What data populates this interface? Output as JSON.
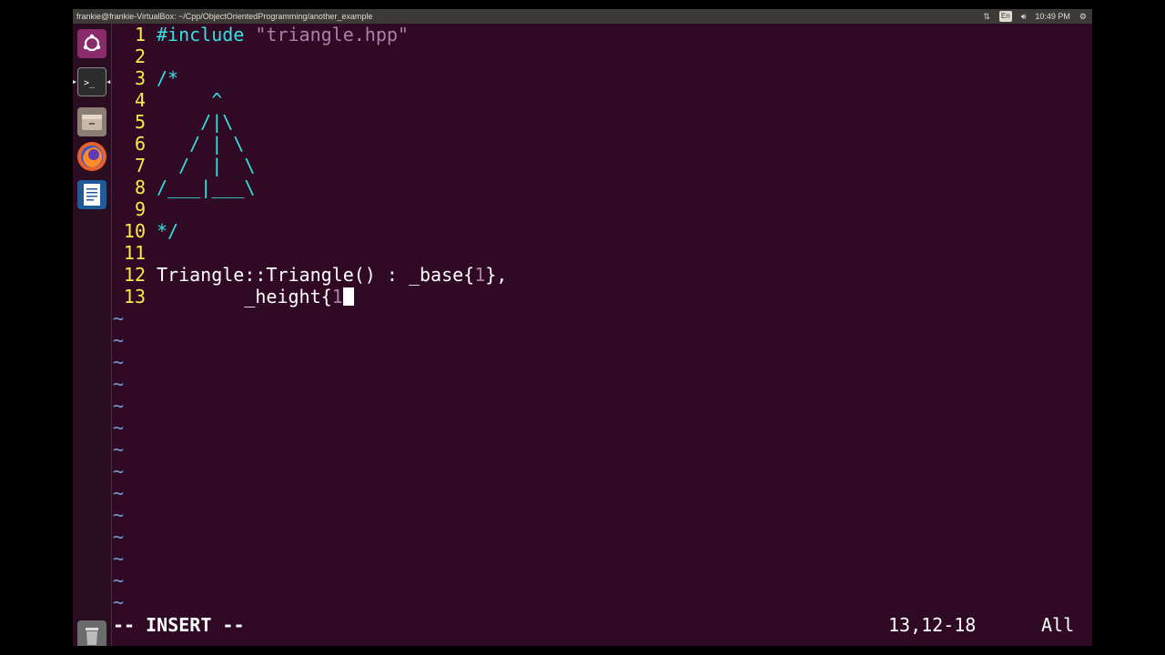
{
  "topbar": {
    "title": "frankie@frankie-VirtualBox: ~/Cpp/ObjectOrientedProgramming/another_example",
    "lang": "En",
    "clock": "10:49 PM"
  },
  "editor": {
    "lines": [
      {
        "num": "1",
        "parts": [
          {
            "t": "#include ",
            "c": "c-pre"
          },
          {
            "t": "\"triangle.hpp\"",
            "c": "c-str"
          }
        ]
      },
      {
        "num": "2",
        "parts": []
      },
      {
        "num": "3",
        "parts": [
          {
            "t": "/*",
            "c": "c-com"
          }
        ]
      },
      {
        "num": "4",
        "parts": [
          {
            "t": "     ^",
            "c": "c-com"
          }
        ]
      },
      {
        "num": "5",
        "parts": [
          {
            "t": "    /|\\",
            "c": "c-com"
          }
        ]
      },
      {
        "num": "6",
        "parts": [
          {
            "t": "   / | \\",
            "c": "c-com"
          }
        ]
      },
      {
        "num": "7",
        "parts": [
          {
            "t": "  /  |  \\",
            "c": "c-com"
          }
        ]
      },
      {
        "num": "8",
        "parts": [
          {
            "t": "/___|___\\",
            "c": "c-com"
          }
        ]
      },
      {
        "num": "9",
        "parts": []
      },
      {
        "num": "10",
        "parts": [
          {
            "t": "*/",
            "c": "c-com"
          }
        ]
      },
      {
        "num": "11",
        "parts": []
      },
      {
        "num": "12",
        "parts": [
          {
            "t": "Triangle::Triangle() : _base{",
            "c": ""
          },
          {
            "t": "1",
            "c": "c-num"
          },
          {
            "t": "},",
            "c": ""
          }
        ]
      },
      {
        "num": "13",
        "parts": [
          {
            "t": "        _height{",
            "c": ""
          },
          {
            "t": "1",
            "c": "c-num"
          }
        ]
      }
    ],
    "tildes": 14,
    "tilde_char": "~"
  },
  "status": {
    "mode": "-- INSERT --",
    "position": "13,12-18",
    "scroll": "All"
  },
  "colors": {
    "background": "#300a24",
    "line_number": "#fce94f",
    "comment": "#34e2e2",
    "string": "#ad7fa8"
  }
}
